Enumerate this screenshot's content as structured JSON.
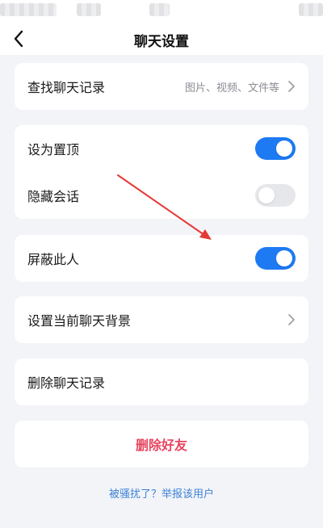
{
  "nav": {
    "title": "聊天设置"
  },
  "search_card": {
    "label": "查找聊天记录",
    "hint": "图片、视频、文件等"
  },
  "pin_card": {
    "pin": {
      "label": "设为置顶",
      "enabled": true
    },
    "hide": {
      "label": "隐藏会话",
      "enabled": false
    }
  },
  "block_card": {
    "label": "屏蔽此人",
    "enabled": true
  },
  "background_card": {
    "label": "设置当前聊天背景"
  },
  "clear_card": {
    "label": "删除聊天记录"
  },
  "delete_card": {
    "label": "删除好友"
  },
  "report_link": {
    "label": "被骚扰了？举报该用户"
  },
  "colors": {
    "accent": "#1d7af3",
    "danger": "#e74560",
    "link": "#3d82d6",
    "annotation_arrow": "#e53935"
  }
}
